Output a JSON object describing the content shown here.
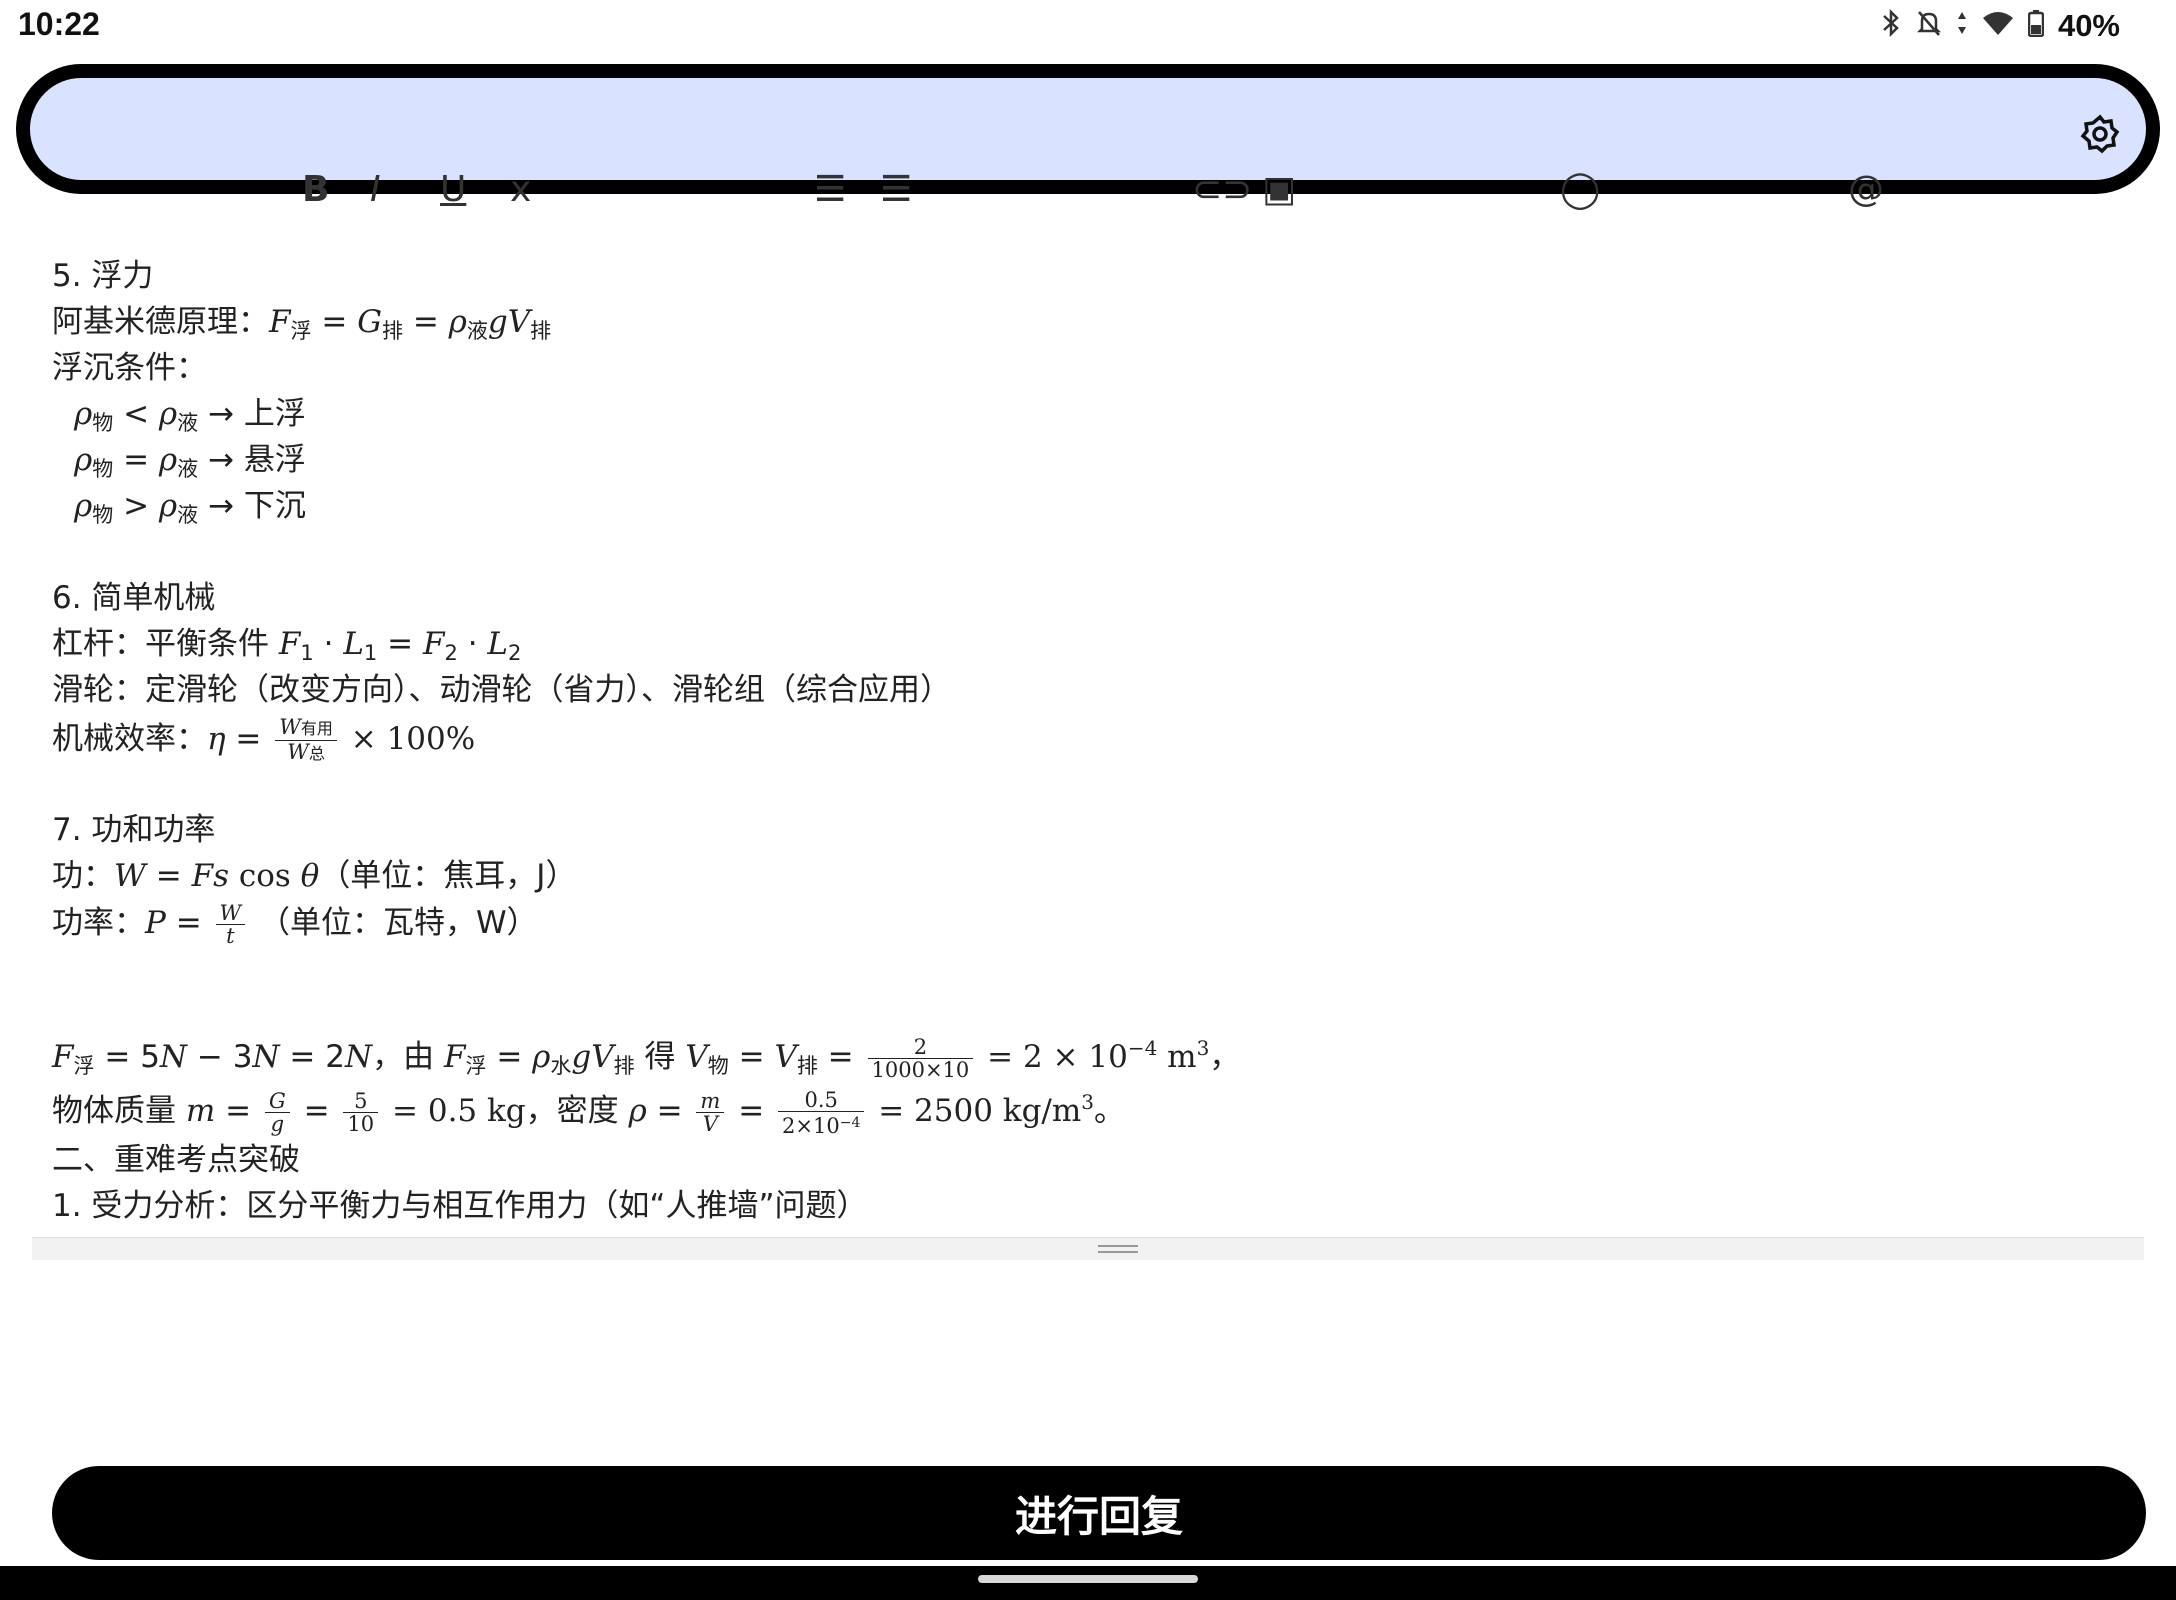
{
  "status_bar": {
    "time": "10:22",
    "battery": "40%"
  },
  "toolbar": {
    "settings_icon": "gear-icon",
    "ghost_icons": [
      "bold-icon",
      "italic-icon",
      "underline-icon",
      "strike-icon",
      "bullet-list-icon",
      "numbered-list-icon",
      "link-icon",
      "image-icon",
      "emoji-icon",
      "mention-icon"
    ]
  },
  "content": {
    "s5_title": "5. 浮力",
    "archimedes_label": "阿基米德原理：",
    "float_label": "浮沉条件：",
    "cond1_result": "→ 上浮",
    "cond2_result": "→ 悬浮",
    "cond3_result": "→ 下沉",
    "s6_title": "6. 简单机械",
    "lever_label": "杠杆：平衡条件 ",
    "pulley_line": "滑轮：定滑轮（改变方向）、动滑轮（省力）、滑轮组（综合应用）",
    "efficiency_label": "机械效率：",
    "efficiency_tail": "× 100%",
    "s7_title": "7. 功和功率",
    "work_label": "功：",
    "work_unit": "（单位：焦耳，J）",
    "power_label": "功率：",
    "power_unit": "（单位：瓦特，W）",
    "calc_text_1": "由",
    "calc_text_2": "得",
    "mass_label": "物体质量 ",
    "density_label": "，密度 ",
    "section2_title": "二、重难考点突破",
    "item1": "1. 受力分析：区分平衡力与相互作用力（如“人推墙”问题）"
  },
  "reply_button_label": "进行回复"
}
